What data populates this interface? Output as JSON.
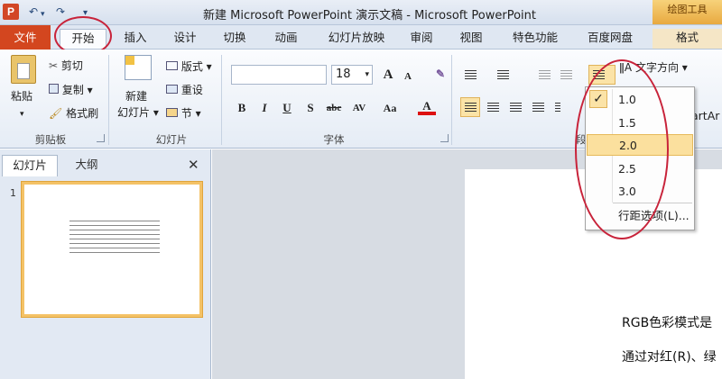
{
  "titlebar": {
    "title": "新建 Microsoft PowerPoint 演示文稿 - Microsoft PowerPoint",
    "contextual_header": "绘图工具",
    "qat": {
      "logo": "P",
      "undo": "↶",
      "redo": "↷",
      "customize": "▾"
    }
  },
  "tabs": {
    "file": "文件",
    "home": "开始",
    "insert": "插入",
    "design": "设计",
    "transitions": "切换",
    "animations": "动画",
    "slideshow": "幻灯片放映",
    "review": "审阅",
    "view": "视图",
    "special": "特色功能",
    "baidu": "百度网盘",
    "format": "格式"
  },
  "ribbon": {
    "clipboard": {
      "paste": "粘贴",
      "cut": "剪切",
      "copy": "复制",
      "format_painter": "格式刷",
      "label": "剪贴板"
    },
    "slides": {
      "new_slide": "新建",
      "new_slide_2": "幻灯片",
      "layout": "版式",
      "reset": "重设",
      "section": "节",
      "label": "幻灯片"
    },
    "font": {
      "font_name": "",
      "font_size": "18",
      "grow": "A",
      "shrink": "A",
      "bold": "B",
      "italic": "I",
      "underline": "U",
      "shadow": "S",
      "strike": "abc",
      "spacing": "AV",
      "case": "Aa",
      "color": "A",
      "label": "字体"
    },
    "paragraph": {
      "text_direction": "文字方向",
      "label": "段"
    },
    "drawing_partial": "artAr"
  },
  "line_spacing_menu": {
    "options": [
      "1.0",
      "1.5",
      "2.0",
      "2.5",
      "3.0"
    ],
    "checked": "1.0",
    "highlighted": "2.0",
    "more": "行距选项(L)..."
  },
  "left_pane": {
    "tab_slides": "幻灯片",
    "tab_outline": "大纲",
    "close": "✕",
    "slide_number": "1"
  },
  "slide": {
    "line1": "RGB色彩模式是",
    "line2": "通过对红(R)、绿"
  },
  "colors": {
    "file_tab": "#d3461f",
    "highlight": "#fbe09e",
    "annotation": "#c8233a"
  }
}
